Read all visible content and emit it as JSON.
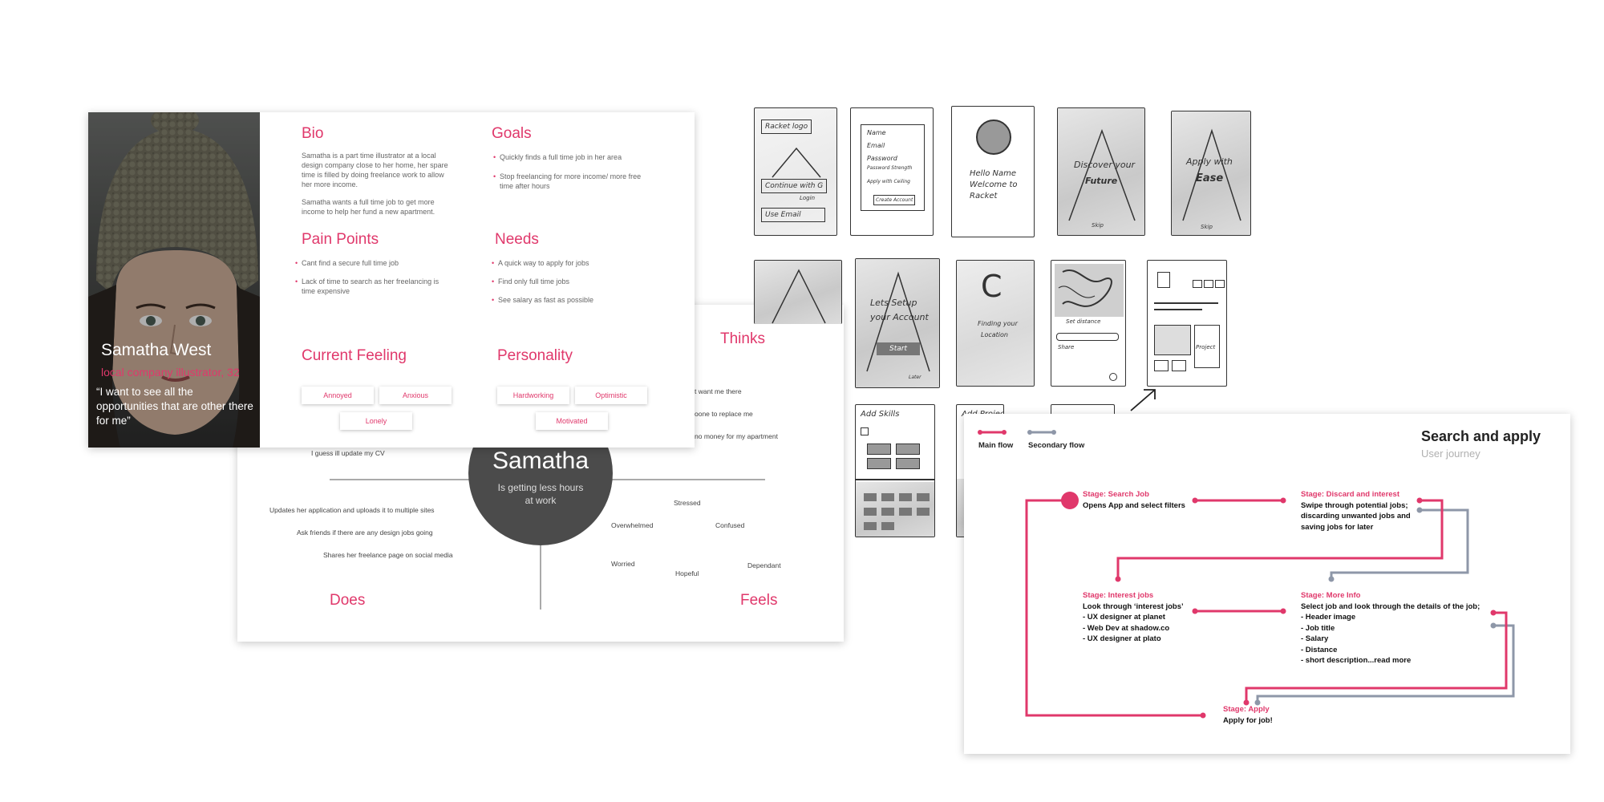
{
  "persona": {
    "name": "Samatha West",
    "role": "local company illustrator, 32",
    "quote": "“I want to see all the opportunities that are other there for me”",
    "bio_title": "Bio",
    "bio_p1": "Samatha is a part time illustrator at a local design company close to her home, her spare time is filled by doing freelance work to allow her more income.",
    "bio_p2": "Samatha wants a full time job to get more income to help her fund a new apartment.",
    "goals_title": "Goals",
    "goals": [
      "Quickly finds a full time job in her area",
      "Stop freelancing for more income/ more free time after hours"
    ],
    "pain_title": "Pain Points",
    "pain": [
      "Cant find a secure full time job",
      "Lack of time to search as her freelancing is time expensive"
    ],
    "needs_title": "Needs",
    "needs": [
      "A quick way to apply for jobs",
      "Find only full time jobs",
      "See salary as fast as possible"
    ],
    "feeling_title": "Current Feeling",
    "feelings": [
      "Annoyed",
      "Anxious",
      "Lonely"
    ],
    "personality_title": "Personality",
    "traits": [
      "Hardworking",
      "Optimistic",
      "Motivated"
    ]
  },
  "empathy": {
    "center_name": "Samatha",
    "center_sub": "Is getting less hours at work",
    "thinks_title": "Thinks",
    "does_title": "Does",
    "feels_title": "Feels",
    "thinks": [
      "t want me there",
      "oone to replace me",
      "no money for my apartment"
    ],
    "says": [
      "I guess ill update my CV"
    ],
    "does": [
      "Updates her application and uploads it to multiple sites",
      "Ask friends if there are any design jobs going",
      "Shares her freelance page on social media"
    ],
    "feels": [
      "Stressed",
      "Overwhelmed",
      "Confused",
      "Worried",
      "Hopeful",
      "Dependant"
    ]
  },
  "sketches": {
    "s1": [
      "Racket logo",
      "Continue with G",
      "Login",
      "Use Email"
    ],
    "s2": [
      "Name",
      "Email",
      "Password",
      "Password Strength",
      "Apply with Ceiling",
      "Create Account"
    ],
    "s3": [
      "Hello Name",
      "Welcome to",
      "Racket"
    ],
    "s4": [
      "Discover your",
      "Future",
      "Skip"
    ],
    "s5": [
      "Apply with",
      "Ease",
      "Skip"
    ],
    "s7": [
      "Lets Setup",
      "your Account",
      "Start",
      "Later"
    ],
    "s8": [
      "C",
      "Finding your",
      "Location"
    ],
    "s9": [
      "Set distance",
      "Share"
    ],
    "s10": [
      "Project"
    ],
    "s11": [
      "Add Skills"
    ],
    "s12": [
      "Add Projects"
    ]
  },
  "journey": {
    "title": "Search and apply",
    "subtitle": "User journey",
    "legend_main": "Main flow",
    "legend_secondary": "Secondary flow",
    "colors": {
      "main": "#e0386b",
      "secondary": "#8e97a8"
    },
    "stages": [
      {
        "title": "Stage: Search Job",
        "lines": [
          "Opens App and select filters"
        ]
      },
      {
        "title": "Stage: Discard and interest",
        "lines": [
          "Swipe through potential jobs;",
          "discarding unwanted jobs and",
          "saving jobs for later"
        ]
      },
      {
        "title": "Stage: Interest jobs",
        "lines": [
          "Look through ‘interest jobs’",
          "- UX designer at planet",
          "- Web Dev at shadow.co",
          "- UX designer at plato"
        ]
      },
      {
        "title": "Stage: More Info",
        "lines": [
          "Select job and look through the details of the job;",
          "- Header image",
          "- Job title",
          "- Salary",
          "- Distance",
          "- short description...read more"
        ]
      },
      {
        "title": "Stage: Apply",
        "lines": [
          "Apply for job!"
        ]
      }
    ]
  }
}
